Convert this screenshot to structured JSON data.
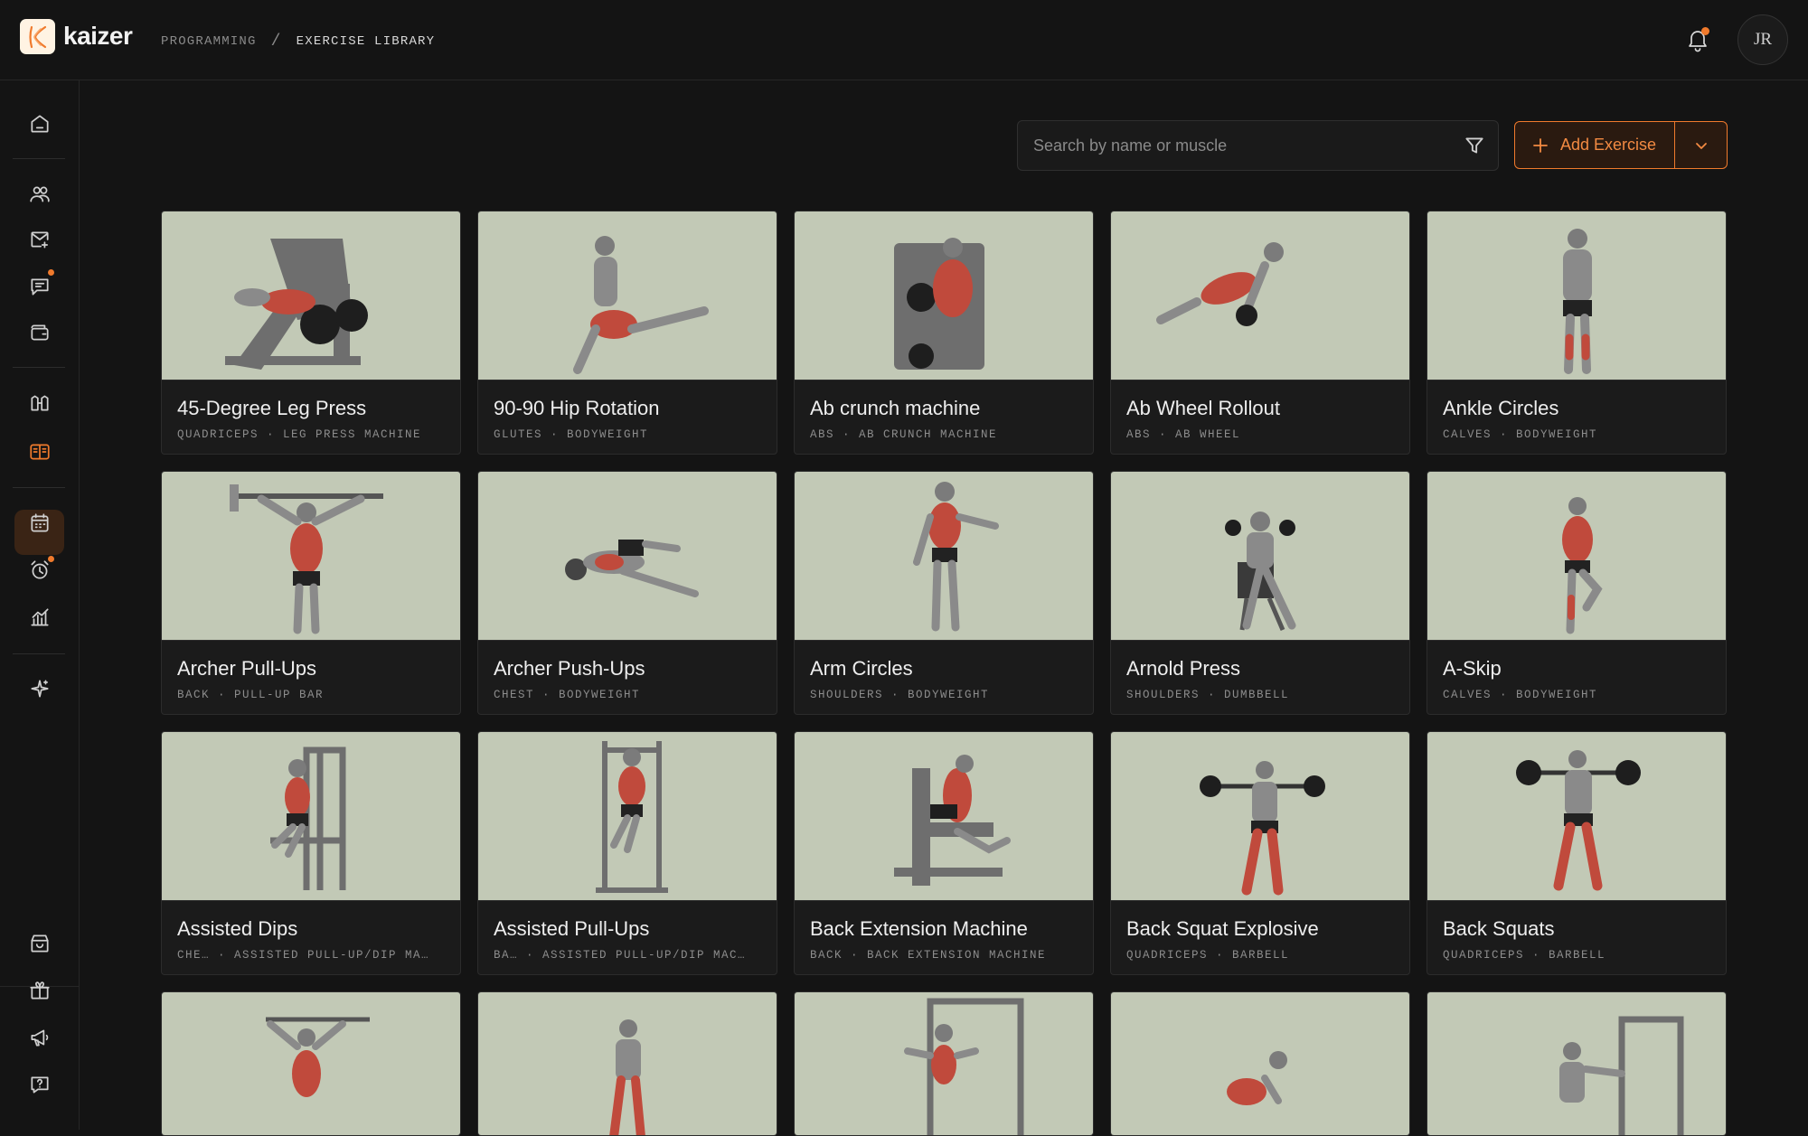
{
  "app": {
    "name": "kaizer"
  },
  "breadcrumb": {
    "parent": "PROGRAMMING",
    "separator": "/",
    "current": "EXERCISE LIBRARY"
  },
  "user": {
    "initials": "JR"
  },
  "search": {
    "placeholder": "Search by name or muscle",
    "value": ""
  },
  "actions": {
    "add_label": "Add Exercise"
  },
  "colors": {
    "accent": "#f07a2c",
    "card_image_bg": "#c2c9b6",
    "page_bg": "#141414"
  },
  "sidebar": {
    "top_icons": [
      "home-icon",
      "clients-icon",
      "inbox-icon",
      "messages-icon",
      "wallet-icon",
      "programs-icon",
      "exercise-library-icon",
      "calendar-icon",
      "alarm-icon",
      "analytics-icon",
      "ai-sparkle-icon"
    ],
    "bottom_icons": [
      "store-icon",
      "gift-icon",
      "megaphone-icon",
      "help-icon"
    ],
    "active": "exercise-library-icon"
  },
  "exercises": [
    {
      "name": "45-Degree Leg Press",
      "meta": "QUADRICEPS · LEG PRESS MACHINE"
    },
    {
      "name": "90-90 Hip Rotation",
      "meta": "GLUTES · BODYWEIGHT"
    },
    {
      "name": "Ab crunch machine",
      "meta": "ABS · AB CRUNCH MACHINE"
    },
    {
      "name": "Ab Wheel Rollout",
      "meta": "ABS · AB WHEEL"
    },
    {
      "name": "Ankle Circles",
      "meta": "CALVES · BODYWEIGHT"
    },
    {
      "name": "Archer Pull-Ups",
      "meta": "BACK · PULL-UP BAR"
    },
    {
      "name": "Archer Push-Ups",
      "meta": "CHEST · BODYWEIGHT"
    },
    {
      "name": "Arm Circles",
      "meta": "SHOULDERS · BODYWEIGHT"
    },
    {
      "name": "Arnold Press",
      "meta": "SHOULDERS · DUMBBELL"
    },
    {
      "name": "A-Skip",
      "meta": "CALVES · BODYWEIGHT"
    },
    {
      "name": "Assisted Dips",
      "meta": "CHE… · ASSISTED PULL-UP/DIP MA…"
    },
    {
      "name": "Assisted Pull-Ups",
      "meta": "BA… · ASSISTED PULL-UP/DIP MAC…"
    },
    {
      "name": "Back Extension Machine",
      "meta": "BACK · BACK EXTENSION MACHINE"
    },
    {
      "name": "Back Squat Explosive",
      "meta": "QUADRICEPS · BARBELL"
    },
    {
      "name": "Back Squats",
      "meta": "QUADRICEPS · BARBELL"
    }
  ]
}
